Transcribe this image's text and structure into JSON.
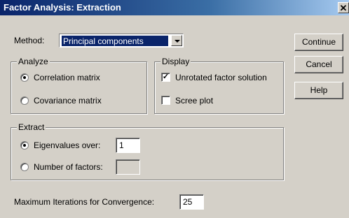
{
  "window": {
    "title": "Factor Analysis: Extraction",
    "close": "✕"
  },
  "method": {
    "label": "Method:",
    "value": "Principal components"
  },
  "buttons": {
    "continue": "Continue",
    "cancel": "Cancel",
    "help": "Help"
  },
  "analyze": {
    "title": "Analyze",
    "correlation": "Correlation matrix",
    "covariance": "Covariance matrix",
    "selected": "correlation"
  },
  "display": {
    "title": "Display",
    "unrotated": "Unrotated factor solution",
    "unrotated_checked": true,
    "scree": "Scree plot",
    "scree_checked": false
  },
  "extract": {
    "title": "Extract",
    "eigen_label": "Eigenvalues over:",
    "eigen_value": "1",
    "nfactors_label": "Number of factors:",
    "nfactors_value": "",
    "selected": "eigen"
  },
  "iterations": {
    "label": "Maximum Iterations for Convergence:",
    "value": "25"
  }
}
